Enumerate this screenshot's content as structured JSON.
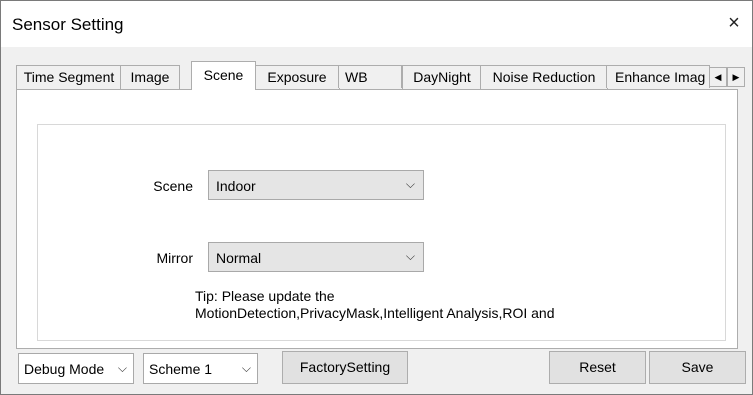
{
  "window": {
    "title": "Sensor Setting",
    "close_glyph": "×"
  },
  "tabs": [
    {
      "label": "Time Segment",
      "active": false
    },
    {
      "label": "Image",
      "active": false
    },
    {
      "label": "Scene",
      "active": true
    },
    {
      "label": "Exposure",
      "active": false
    },
    {
      "label": "WB",
      "active": false
    },
    {
      "label": "DayNight",
      "active": false
    },
    {
      "label": "Noise Reduction",
      "active": false
    },
    {
      "label": "Enhance Imag",
      "active": false
    }
  ],
  "tab_scroll": {
    "left_icon": "◀",
    "right_icon": "▶"
  },
  "scene": {
    "label": "Scene",
    "value": "Indoor"
  },
  "mirror": {
    "label": "Mirror",
    "value": "Normal"
  },
  "tip": {
    "line1": "Tip: Please update the",
    "line2": "MotionDetection,PrivacyMask,Intelligent Analysis,ROI and"
  },
  "bottom": {
    "mode_value": "Debug Mode",
    "scheme_value": "Scheme 1",
    "factory_label": "FactorySetting",
    "reset_label": "Reset",
    "save_label": "Save"
  },
  "chevron": "⌵"
}
